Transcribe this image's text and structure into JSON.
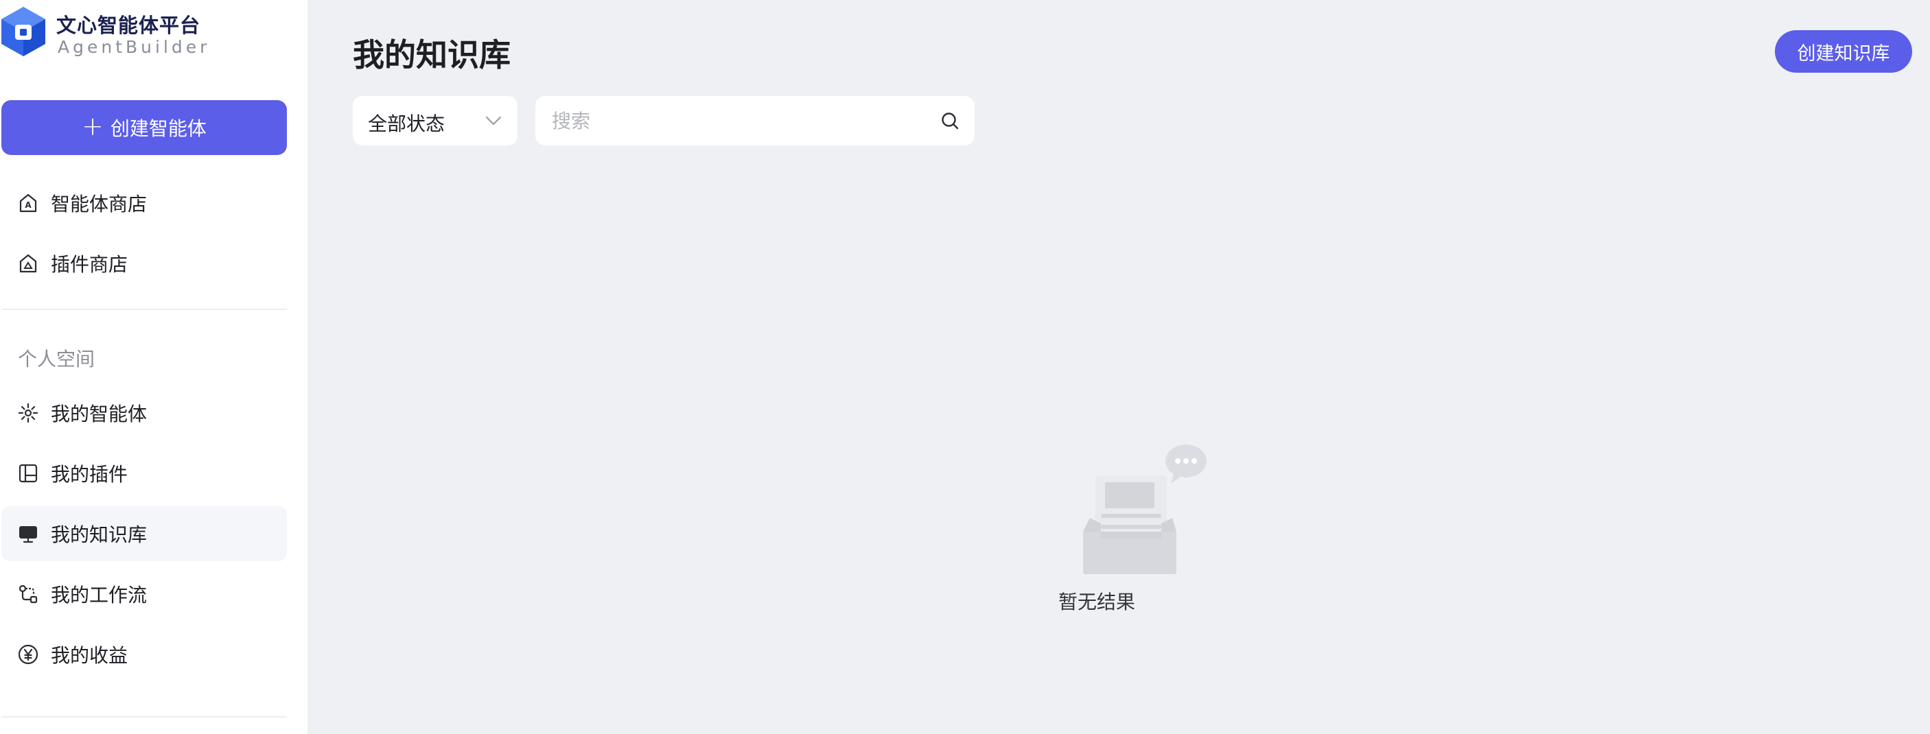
{
  "app": {
    "title": "文心智能体平台",
    "subtitle": "AgentBuilder",
    "brand_color": "#3366e6",
    "accent_color": "#5b5ee8"
  },
  "sidebar": {
    "create_button": {
      "label": "创建智能体",
      "icon": "plus-icon"
    },
    "store_items": [
      {
        "label": "智能体商店",
        "icon": "agent-store-icon"
      },
      {
        "label": "插件商店",
        "icon": "plugin-store-icon"
      }
    ],
    "section_label": "个人空间",
    "personal_items": [
      {
        "label": "我的智能体",
        "icon": "sparkle-icon"
      },
      {
        "label": "我的插件",
        "icon": "layout-icon"
      },
      {
        "label": "我的知识库",
        "icon": "monitor-icon",
        "active": true
      },
      {
        "label": "我的工作流",
        "icon": "workflow-icon"
      },
      {
        "label": "我的收益",
        "icon": "yen-icon"
      }
    ]
  },
  "main": {
    "page_title": "我的知识库",
    "create_kb_button": "创建知识库",
    "filter": {
      "selected": "全部状态",
      "icon": "chevron-down-icon"
    },
    "search": {
      "placeholder": "搜索",
      "value": "",
      "icon": "search-icon"
    },
    "empty_state": {
      "text": "暂无结果",
      "icon": "empty-inbox-icon"
    }
  }
}
